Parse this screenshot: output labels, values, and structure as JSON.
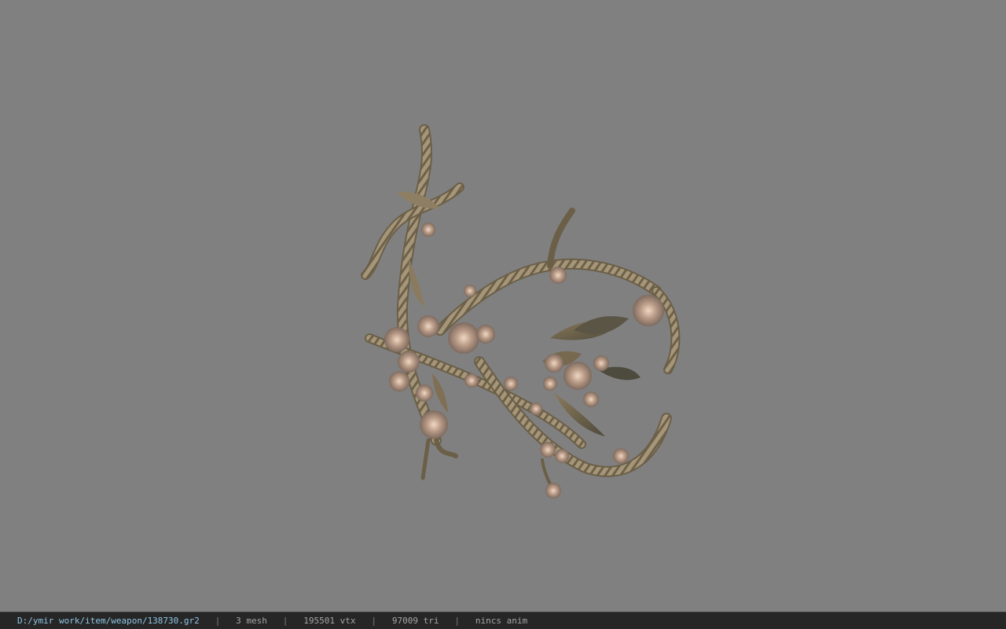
{
  "viewer": {
    "background_color": "#808080",
    "model_description_icon": "thorn-vine-weapon-model"
  },
  "status_bar": {
    "file_path": "D:/ymir work/item/weapon/138730.gr2",
    "separator": "|",
    "mesh_count": "3 mesh",
    "vertex_count": "195501 vtx",
    "triangle_count": "97009 tri",
    "animation": "nincs anim",
    "colors": {
      "background": "#262626",
      "path": "#8fc6e6",
      "text": "#a6a6a6"
    }
  }
}
